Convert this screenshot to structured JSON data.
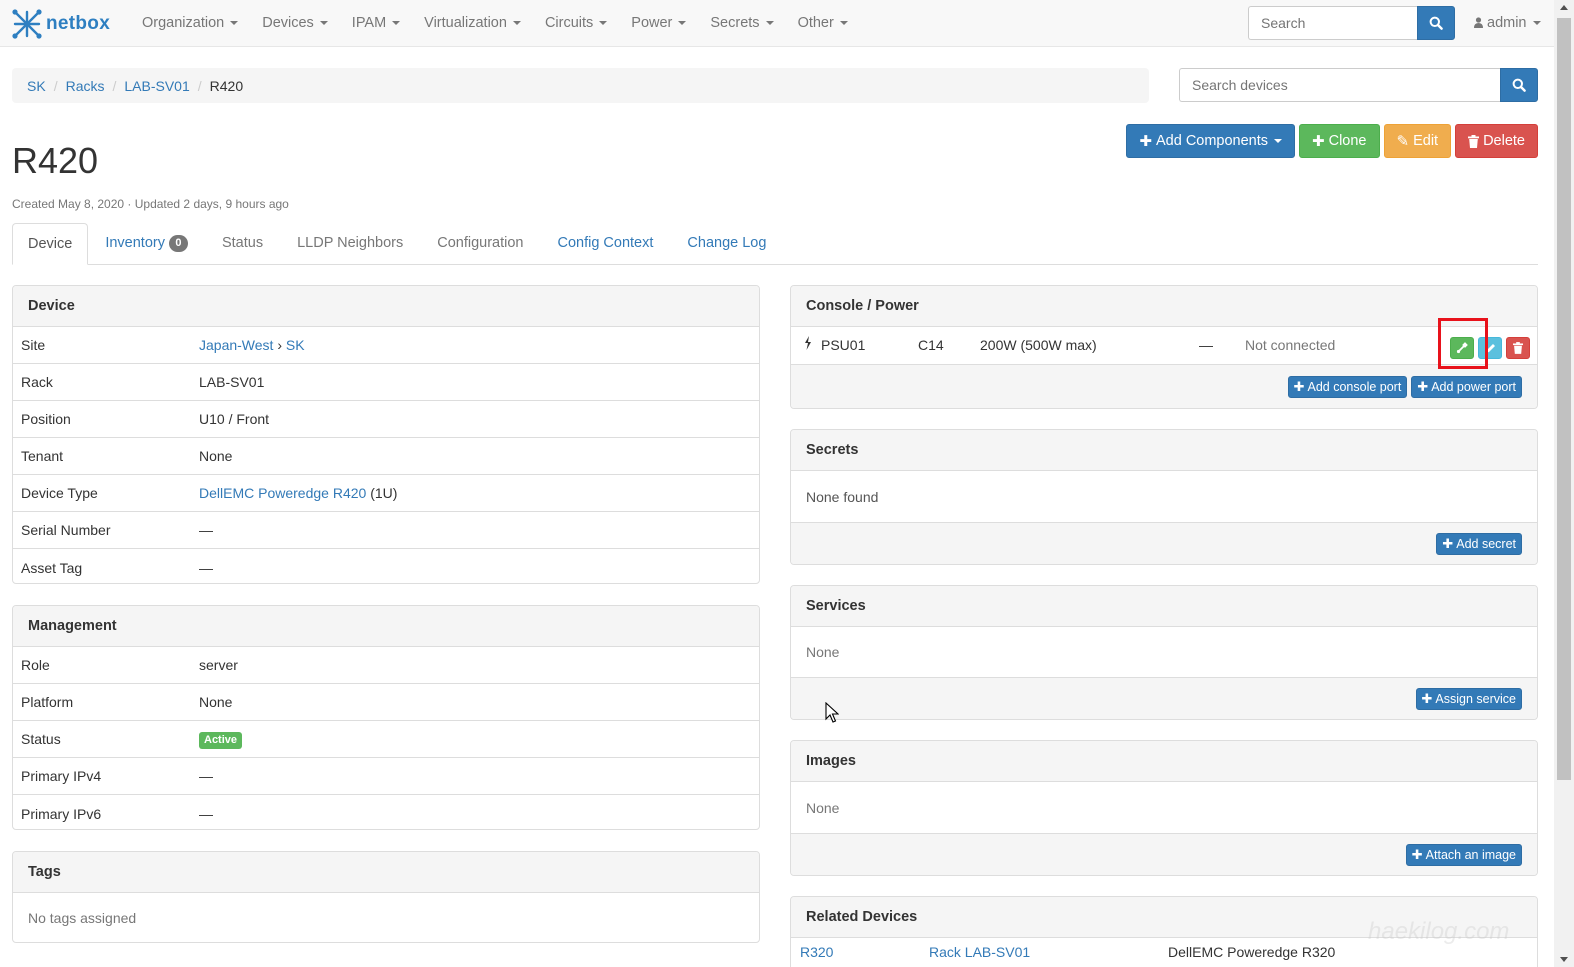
{
  "navbar": {
    "brand": "netbox",
    "menu": [
      {
        "label": "Organization"
      },
      {
        "label": "Devices"
      },
      {
        "label": "IPAM"
      },
      {
        "label": "Virtualization"
      },
      {
        "label": "Circuits"
      },
      {
        "label": "Power"
      },
      {
        "label": "Secrets"
      },
      {
        "label": "Other"
      }
    ],
    "search_placeholder": "Search",
    "user": "admin"
  },
  "breadcrumb": [
    "SK",
    "Racks",
    "LAB-SV01",
    "R420"
  ],
  "device_search_placeholder": "Search devices",
  "title": "R420",
  "meta": "Created May 8, 2020 · Updated 2 days, 9 hours ago",
  "actions": {
    "add_components": "Add Components",
    "clone": "Clone",
    "edit": "Edit",
    "delete": "Delete"
  },
  "tabs": [
    {
      "label": "Device",
      "state": "active"
    },
    {
      "label": "Inventory",
      "badge": "0"
    },
    {
      "label": "Status",
      "state": "disabled"
    },
    {
      "label": "LLDP Neighbors",
      "state": "disabled"
    },
    {
      "label": "Configuration",
      "state": "disabled"
    },
    {
      "label": "Config Context"
    },
    {
      "label": "Change Log"
    }
  ],
  "device_panel": {
    "heading": "Device",
    "site_label": "Site",
    "site_region": "Japan-West",
    "site_arrow": "›",
    "site_name": "SK",
    "rack_label": "Rack",
    "rack_value": "LAB-SV01",
    "position_label": "Position",
    "position_value": "U10 / Front",
    "tenant_label": "Tenant",
    "tenant_value": "None",
    "device_type_label": "Device Type",
    "device_type_value": "DellEMC Poweredge R420",
    "device_type_height": "(1U)",
    "serial_label": "Serial Number",
    "serial_value": "—",
    "asset_label": "Asset Tag",
    "asset_value": "—"
  },
  "management_panel": {
    "heading": "Management",
    "role_label": "Role",
    "role_value": "server",
    "platform_label": "Platform",
    "platform_value": "None",
    "status_label": "Status",
    "status_value": "Active",
    "ipv4_label": "Primary IPv4",
    "ipv4_value": "—",
    "ipv6_label": "Primary IPv6",
    "ipv6_value": "—"
  },
  "tags_panel": {
    "heading": "Tags",
    "empty": "No tags assigned"
  },
  "console_power": {
    "heading": "Console / Power",
    "port": {
      "name": "PSU01",
      "type": "C14",
      "draw": "200W (500W max)",
      "dash": "—",
      "connection": "Not connected"
    },
    "add_console_port": "Add console port",
    "add_power_port": "Add power port"
  },
  "secrets": {
    "heading": "Secrets",
    "empty": "None found",
    "add_button": "Add secret"
  },
  "services": {
    "heading": "Services",
    "empty": "None",
    "add_button": "Assign service"
  },
  "images": {
    "heading": "Images",
    "empty": "None",
    "add_button": "Attach an image"
  },
  "related_devices": {
    "heading": "Related Devices",
    "rows": [
      {
        "name": "R320",
        "rack": "Rack LAB-SV01",
        "type": "DellEMC Poweredge R320"
      }
    ]
  },
  "watermark": "haekilog.com",
  "colors": {
    "primary": "#337ab7",
    "success": "#5cb85c",
    "warning": "#f0ad4e",
    "danger": "#d9534f",
    "info": "#5bc0de",
    "highlight": "#e8121b"
  }
}
